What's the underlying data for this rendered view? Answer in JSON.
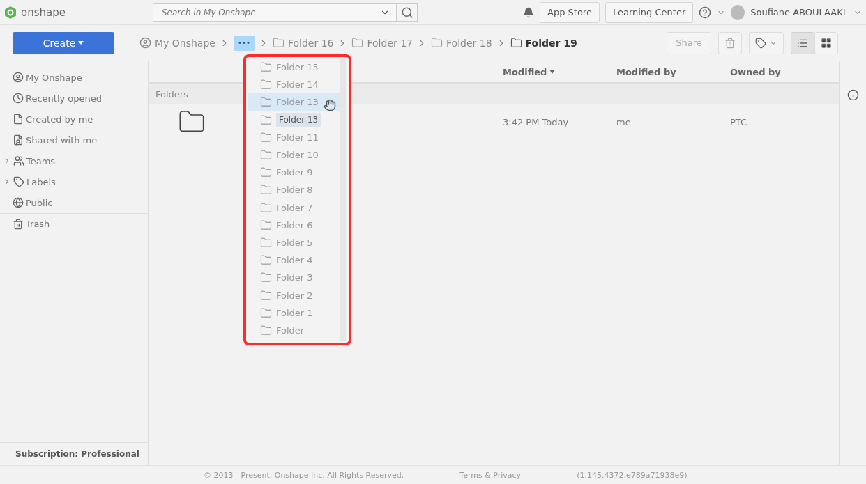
{
  "app": {
    "name": "onshape"
  },
  "search": {
    "placeholder": "Search in My Onshape"
  },
  "header_buttons": [
    "App Store",
    "Learning Center"
  ],
  "user": {
    "name": "Soufiane ABOULAAKL"
  },
  "create_button": "Create",
  "breadcrumbs": [
    {
      "kind": "home",
      "label": "My Onshape"
    },
    {
      "kind": "more",
      "label": "•••"
    },
    {
      "kind": "folder",
      "label": "Folder 16"
    },
    {
      "kind": "folder",
      "label": "Folder 17"
    },
    {
      "kind": "folder",
      "label": "Folder 18"
    },
    {
      "kind": "current",
      "label": "Folder 19"
    }
  ],
  "actions": {
    "share": "Share",
    "disabled": true
  },
  "view_buttons": [
    {
      "kind": "list",
      "selected": true
    },
    {
      "kind": "grid",
      "selected": false
    }
  ],
  "sidebar": {
    "items": [
      {
        "label": "My Onshape",
        "expandable": false
      },
      {
        "label": "Recently opened",
        "expandable": false
      },
      {
        "label": "Created by me",
        "expandable": false
      },
      {
        "label": "Shared with me",
        "expandable": false
      },
      {
        "label": "Teams",
        "expandable": true
      },
      {
        "label": "Labels",
        "expandable": true
      },
      {
        "label": "Public",
        "expandable": false
      },
      {
        "label": "Trash",
        "expandable": false
      }
    ],
    "subscription": "Subscription: Professional"
  },
  "table": {
    "columns": [
      {
        "label": "Modified",
        "sorted": true
      },
      {
        "label": "Modified by",
        "sorted": false
      },
      {
        "label": "Owned by",
        "sorted": false
      }
    ],
    "section": "Folders",
    "rows": [
      {
        "modified": "3:42 PM Today",
        "modified_by": "me",
        "owned_by": "PTC"
      }
    ]
  },
  "dropdown": {
    "items": [
      {
        "kind": "folder",
        "label": "Folder 15",
        "selected": false
      },
      {
        "kind": "folder",
        "label": "Folder 14",
        "selected": false
      },
      {
        "kind": "folder",
        "label": "Folder 13",
        "selected": true
      },
      {
        "kind": "ghost",
        "label": "Folder 13",
        "selected": false
      },
      {
        "kind": "folder",
        "label": "Folder 11",
        "selected": false
      },
      {
        "kind": "folder",
        "label": "Folder 10",
        "selected": false
      },
      {
        "kind": "folder",
        "label": "Folder 9",
        "selected": false
      },
      {
        "kind": "folder",
        "label": "Folder 8",
        "selected": false
      },
      {
        "kind": "folder",
        "label": "Folder 7",
        "selected": false
      },
      {
        "kind": "folder",
        "label": "Folder 6",
        "selected": false
      },
      {
        "kind": "folder",
        "label": "Folder 5",
        "selected": false
      },
      {
        "kind": "folder",
        "label": "Folder 4",
        "selected": false
      },
      {
        "kind": "folder",
        "label": "Folder 3",
        "selected": false
      },
      {
        "kind": "folder",
        "label": "Folder 2",
        "selected": false
      },
      {
        "kind": "folder",
        "label": "Folder 1",
        "selected": false
      },
      {
        "kind": "folder",
        "label": "Folder",
        "selected": false
      }
    ]
  },
  "footer": {
    "copyright": "© 2013 - Present, Onshape Inc. All Rights Reserved.",
    "link": "Terms & Privacy",
    "version": "(1.145.4372.e789a71938e9)"
  }
}
